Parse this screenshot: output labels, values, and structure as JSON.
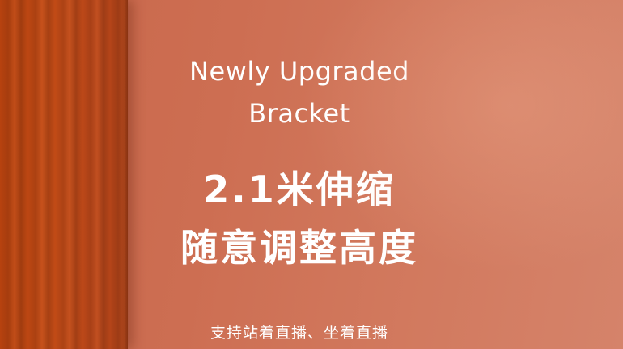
{
  "headline_en": {
    "line1": "Newly Upgraded",
    "line2": "Bracket"
  },
  "headline_cn": {
    "line1": "2.1米伸缩",
    "line2": "随意调整高度"
  },
  "caption": "支持站着直播、坐着直播",
  "colors": {
    "background": "#cd6e52",
    "curtain": "#c24b16",
    "text": "#ffffff"
  }
}
